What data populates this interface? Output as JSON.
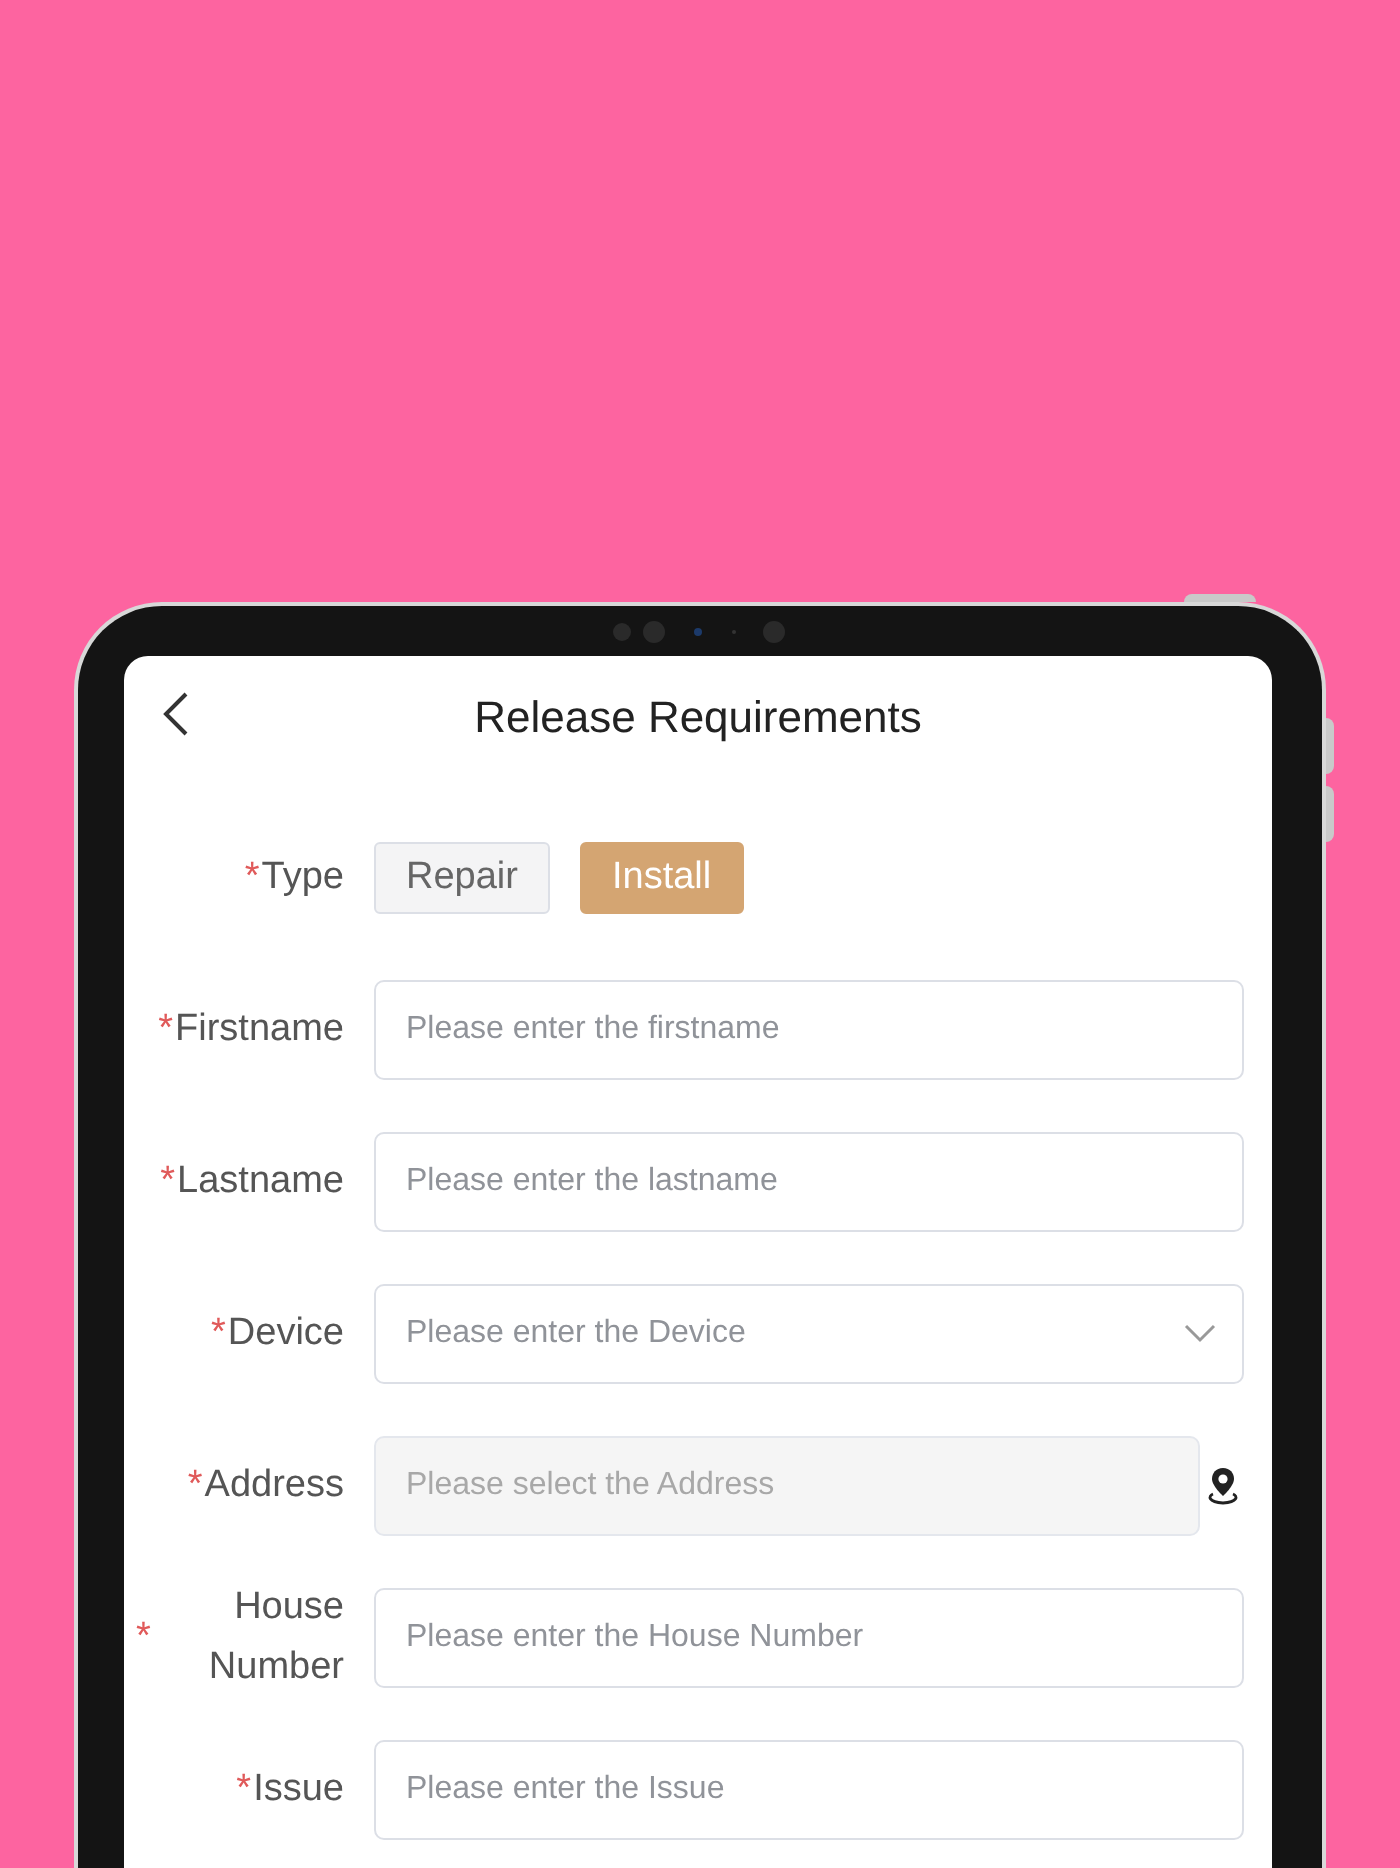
{
  "header": {
    "title": "Release Requirements"
  },
  "form": [
    {
      "kind": "choice",
      "mark": "*",
      "label": "Type",
      "options": [
        {
          "label": "Repair",
          "selected": false
        },
        {
          "label": "Install",
          "selected": true
        }
      ]
    },
    {
      "kind": "text",
      "mark": "*",
      "label": "Firstname",
      "placeholder": "Please enter the firstname"
    },
    {
      "kind": "text",
      "mark": "*",
      "label": "Lastname",
      "placeholder": "Please enter the lastname"
    },
    {
      "kind": "select",
      "mark": "*",
      "label": "Device",
      "placeholder": "Please enter the Device"
    },
    {
      "kind": "location",
      "mark": "*",
      "label": "Address",
      "disabled": true,
      "placeholder": "Please select the Address"
    },
    {
      "kind": "text",
      "mark": "*",
      "label": "House Number",
      "placeholder": "Please enter the House Number"
    },
    {
      "kind": "text",
      "mark": "*",
      "label": "Issue",
      "placeholder": "Please enter the Issue"
    }
  ]
}
